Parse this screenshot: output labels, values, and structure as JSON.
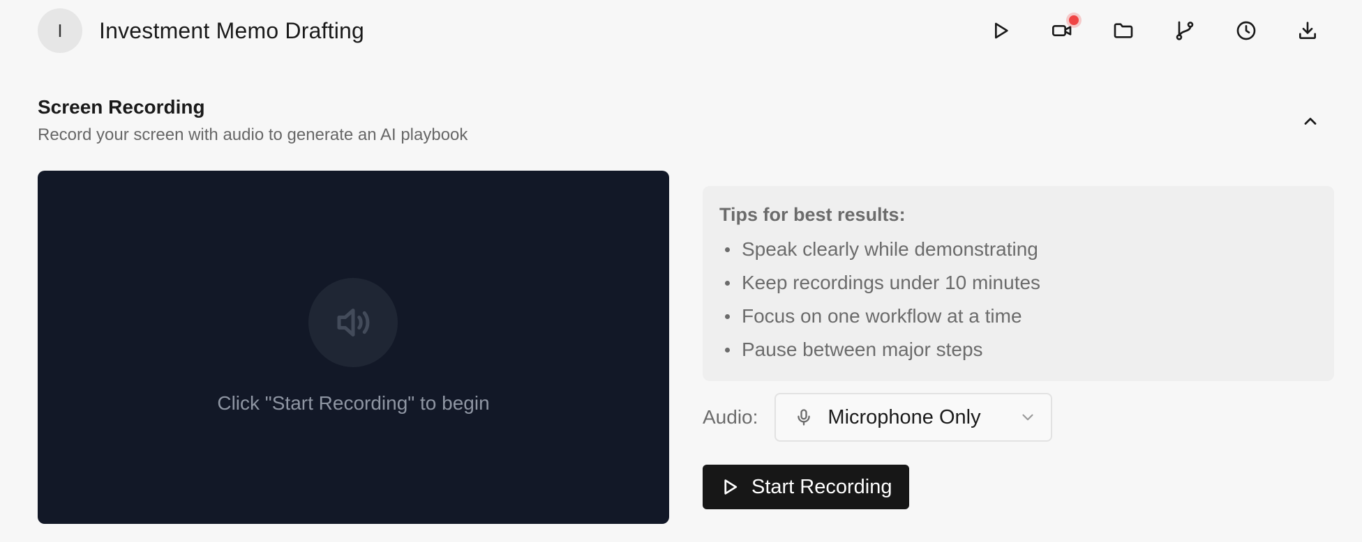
{
  "header": {
    "avatar_initial": "I",
    "title": "Investment Memo Drafting",
    "toolbar": [
      {
        "icon": "play-icon"
      },
      {
        "icon": "video-camera-icon",
        "badge": "recording-dot"
      },
      {
        "icon": "folder-icon"
      },
      {
        "icon": "git-branch-icon"
      },
      {
        "icon": "clock-icon"
      },
      {
        "icon": "download-icon"
      }
    ]
  },
  "section": {
    "title": "Screen Recording",
    "subtitle": "Record your screen with audio to generate an AI playbook"
  },
  "preview": {
    "icon": "speaker-icon",
    "message": "Click \"Start Recording\" to begin"
  },
  "tips": {
    "title": "Tips for best results:",
    "items": [
      "Speak clearly while demonstrating",
      "Keep recordings under 10 minutes",
      "Focus on one workflow at a time",
      "Pause between major steps"
    ]
  },
  "audio": {
    "label": "Audio:",
    "selected": "Microphone Only"
  },
  "start_button": {
    "label": "Start Recording"
  },
  "colors": {
    "background": "#f7f7f7",
    "preview_bg": "#121827",
    "recording_dot": "#ef4444",
    "button_bg": "#171717"
  }
}
